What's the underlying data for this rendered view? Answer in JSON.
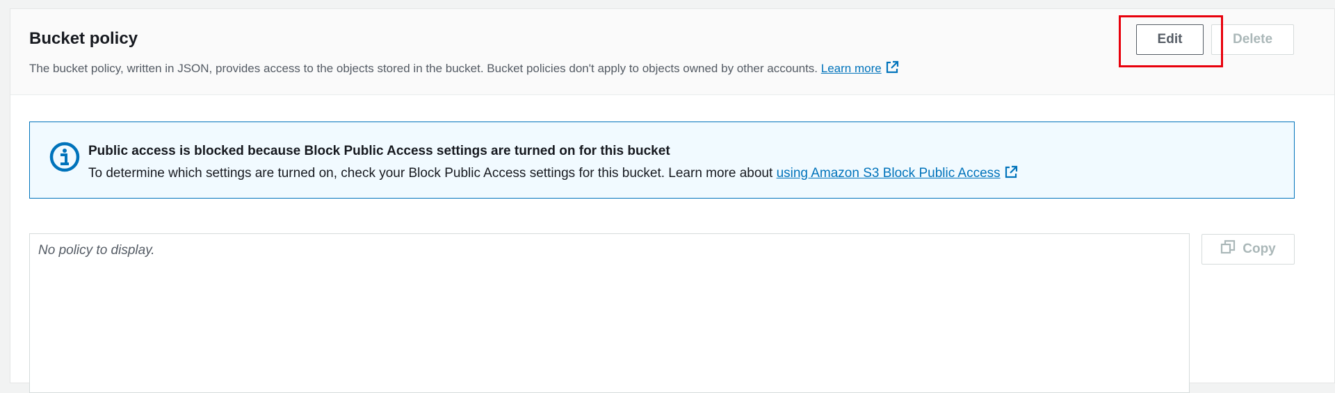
{
  "bucket_policy": {
    "title": "Bucket policy",
    "description": "The bucket policy, written in JSON, provides access to the objects stored in the bucket. Bucket policies don't apply to objects owned by other accounts.",
    "learn_more_label": "Learn more",
    "edit_label": "Edit",
    "delete_label": "Delete"
  },
  "alert": {
    "icon": "info-icon",
    "title": "Public access is blocked because Block Public Access settings are turned on for this bucket",
    "text": "To determine which settings are turned on, check your Block Public Access settings for this bucket. Learn more about",
    "link_label": "using Amazon S3 Block Public Access"
  },
  "policy_editor": {
    "placeholder": "No policy to display.",
    "copy_label": "Copy"
  },
  "colors": {
    "link": "#0073bb",
    "alert_border": "#0073bb",
    "alert_background": "#f1faff",
    "highlight": "#e8000b",
    "disabled_text": "#aab7b8"
  }
}
